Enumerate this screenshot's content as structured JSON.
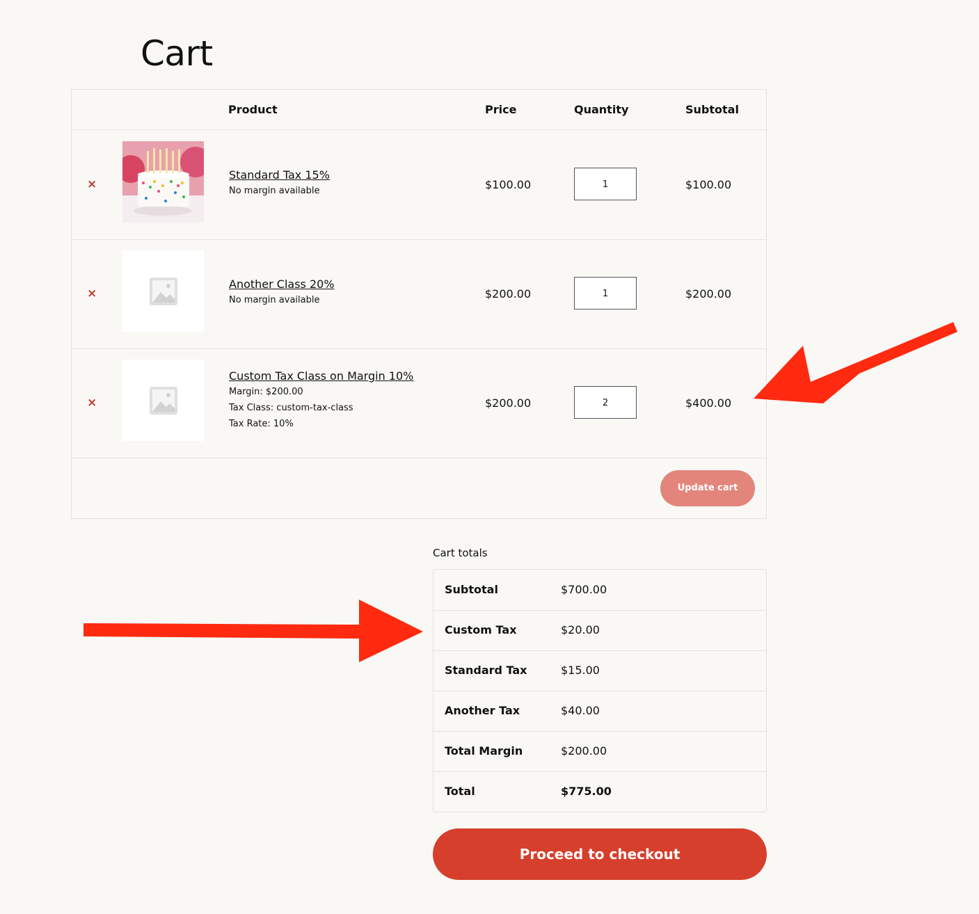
{
  "page": {
    "title": "Cart"
  },
  "table": {
    "headers": {
      "product": "Product",
      "price": "Price",
      "quantity": "Quantity",
      "subtotal": "Subtotal"
    },
    "rows": [
      {
        "name": "Standard Tax 15%",
        "meta": [
          "No margin available"
        ],
        "price": "$100.00",
        "qty": "1",
        "subtotal": "$100.00",
        "remove": "×",
        "image": "birthday-cake-photo"
      },
      {
        "name": "Another Class 20%",
        "meta": [
          "No margin available"
        ],
        "price": "$200.00",
        "qty": "1",
        "subtotal": "$200.00",
        "remove": "×",
        "image": "placeholder-image-icon"
      },
      {
        "name": "Custom Tax Class on Margin 10%",
        "meta": [
          "Margin: $200.00",
          "Tax Class: custom-tax-class",
          "Tax Rate: 10%"
        ],
        "price": "$200.00",
        "qty": "2",
        "subtotal": "$400.00",
        "remove": "×",
        "image": "placeholder-image-icon"
      }
    ],
    "update_label": "Update cart"
  },
  "totals": {
    "title": "Cart totals",
    "rows": [
      {
        "label": "Subtotal",
        "value": "$700.00"
      },
      {
        "label": "Custom Tax",
        "value": "$20.00"
      },
      {
        "label": "Standard Tax",
        "value": "$15.00"
      },
      {
        "label": "Another Tax",
        "value": "$40.00"
      },
      {
        "label": "Total Margin",
        "value": "$200.00"
      },
      {
        "label": "Total",
        "value": "$775.00"
      }
    ]
  },
  "checkout_label": "Proceed to checkout",
  "colors": {
    "accent": "#d63f2c",
    "update": "#e3857b",
    "remove": "#c0392b",
    "arrow": "#ff2a10",
    "background": "#f9f8f5"
  }
}
